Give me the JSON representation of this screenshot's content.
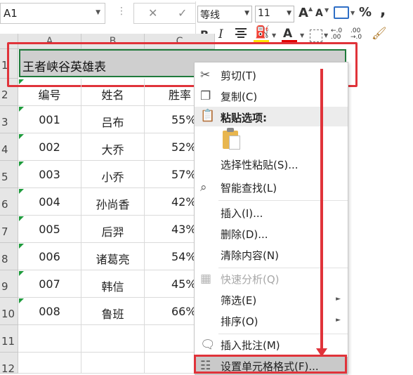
{
  "name_box": {
    "value": "A1"
  },
  "formula_bar": {
    "cancel_icon": "✕",
    "enter_icon": "✓",
    "dots": "⋮"
  },
  "mini_toolbar": {
    "font_name": "等线",
    "font_size": "11",
    "grow": "A",
    "shrink": "A",
    "percent": "%",
    "comma": ",",
    "bold": "B",
    "italic": "I",
    "font_color": "A",
    "fill_color_hex": "#ffe400",
    "font_color_hex": "#e00000",
    "increase_decimal": "←.0\n.00",
    "decrease_decimal": ".00\n→.0"
  },
  "sheet": {
    "columns": [
      "A",
      "B",
      "C"
    ],
    "rows": [
      "1",
      "2",
      "3",
      "4",
      "5",
      "6",
      "7",
      "8",
      "9",
      "10",
      "11",
      "12"
    ],
    "title": "王者峡谷英雄表",
    "headers": [
      "编号",
      "姓名",
      "胜率"
    ],
    "data": [
      [
        "001",
        "吕布",
        "55%"
      ],
      [
        "002",
        "大乔",
        "52%"
      ],
      [
        "003",
        "小乔",
        "57%"
      ],
      [
        "004",
        "孙尚香",
        "42%"
      ],
      [
        "005",
        "后羿",
        "43%"
      ],
      [
        "006",
        "诸葛亮",
        "54%"
      ],
      [
        "007",
        "韩信",
        "45%"
      ],
      [
        "008",
        "鲁班",
        "66%"
      ]
    ]
  },
  "context_menu": {
    "cut": "剪切(T)",
    "copy": "复制(C)",
    "paste_options": "粘贴选项:",
    "paste_special": "选择性粘贴(S)...",
    "smart_lookup": "智能查找(L)",
    "insert": "插入(I)...",
    "delete": "删除(D)...",
    "clear_contents": "清除内容(N)",
    "quick_analysis": "快速分析(Q)",
    "filter": "筛选(E)",
    "sort": "排序(O)",
    "insert_comment": "插入批注(M)",
    "format_cells": "设置单元格格式(F)..."
  },
  "accent": {
    "highlight_red": "#e0333a",
    "selection_green": "#1f7a3b"
  }
}
